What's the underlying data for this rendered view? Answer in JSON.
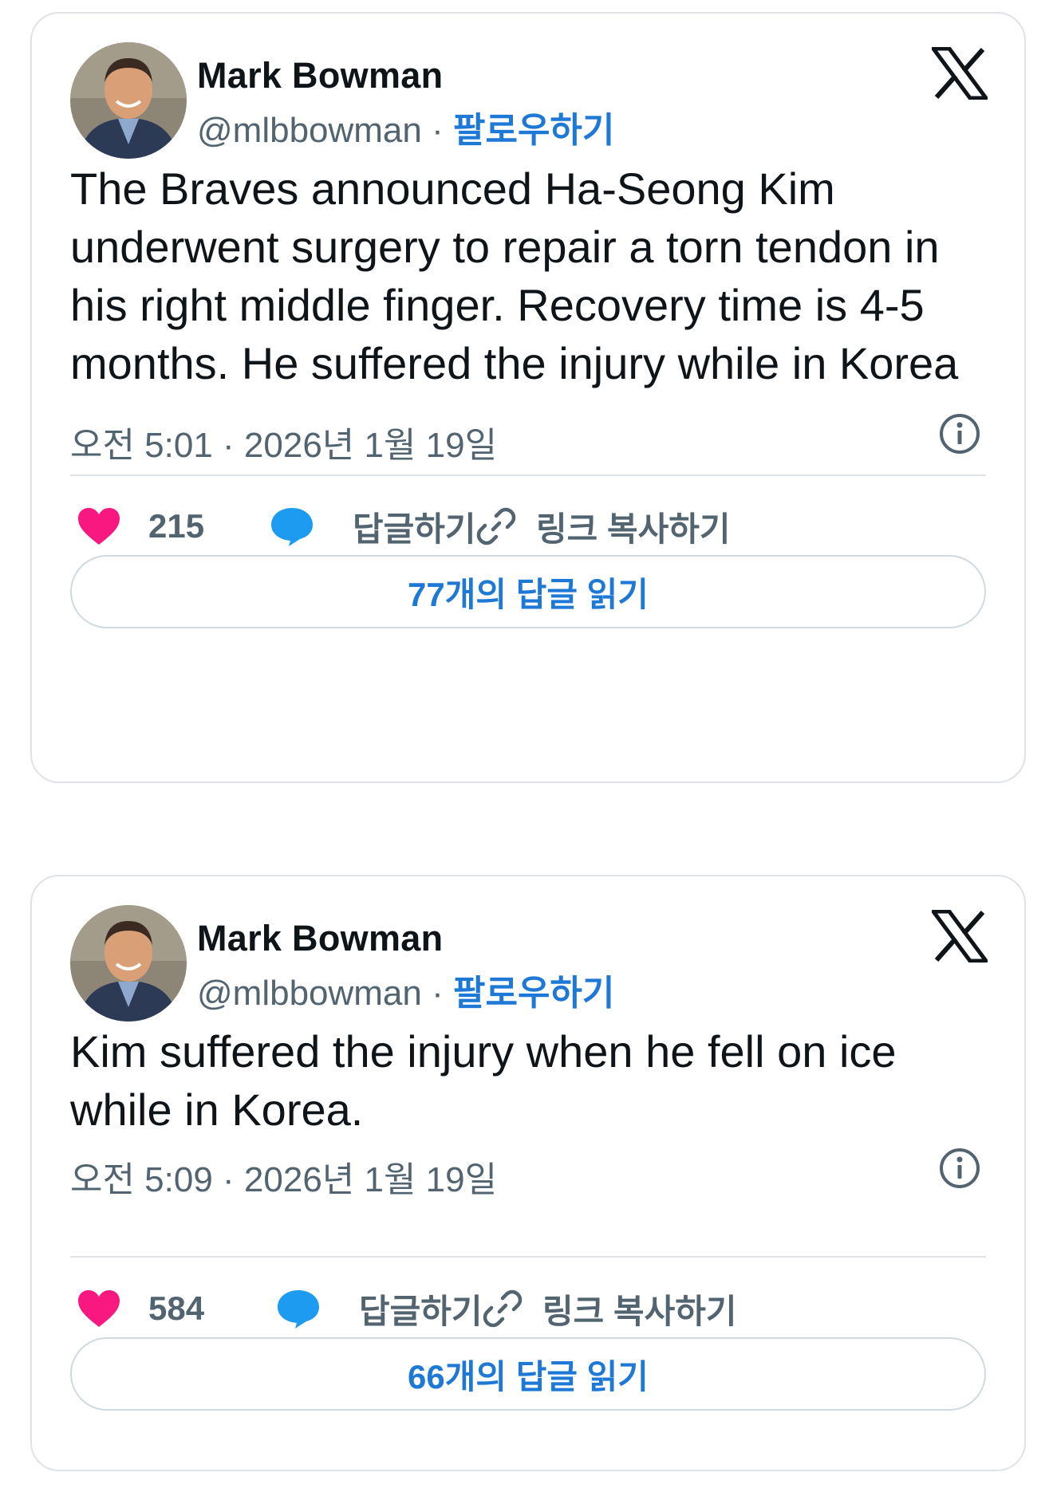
{
  "colors": {
    "accent_blue": "#1d78d6",
    "heart_pink": "#f91880",
    "reply_blue": "#1d9bf0",
    "muted_gray": "#536471",
    "border_gray": "#dfe3e7"
  },
  "tweets": [
    {
      "author_name": "Mark Bowman",
      "handle": "@mlbbowman",
      "separator": " · ",
      "follow_label": "팔로우하기",
      "platform_icon": "x-logo-icon",
      "text": "The Braves announced Ha-Seong Kim underwent surgery to repair a torn tendon in his right middle finger. Recovery time is 4-5 months. He suffered the injury while in Korea",
      "timestamp": "오전 5:01 · 2026년 1월 19일",
      "like_count": "215",
      "reply_label": "답글하기",
      "copy_link_label": "링크 복사하기",
      "read_replies_label": "77개의 답글 읽기"
    },
    {
      "author_name": "Mark Bowman",
      "handle": "@mlbbowman",
      "separator": " · ",
      "follow_label": "팔로우하기",
      "platform_icon": "x-logo-icon",
      "text": "Kim suffered the injury when he fell on ice while in Korea.",
      "timestamp": "오전 5:09 · 2026년 1월 19일",
      "like_count": "584",
      "reply_label": "답글하기",
      "copy_link_label": "링크 복사하기",
      "read_replies_label": "66개의 답글 읽기"
    }
  ]
}
